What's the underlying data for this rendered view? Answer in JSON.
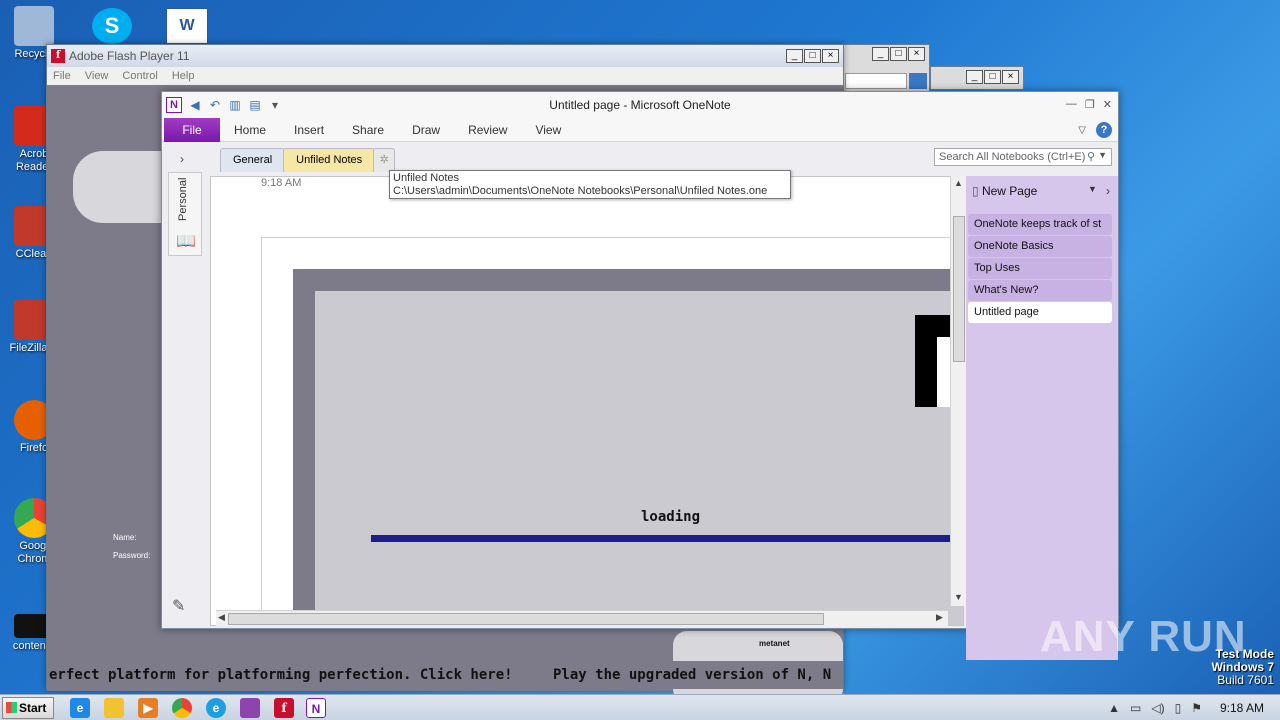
{
  "desktop": {
    "icons": [
      {
        "label": "Recycle",
        "color": "#9fb8d8"
      },
      {
        "label": "Acrob Reader",
        "color": "#d42a1c"
      },
      {
        "label": "CClean",
        "color": "#c0392b"
      },
      {
        "label": "FileZilla C",
        "color": "#c0392b"
      },
      {
        "label": "Firefo",
        "color": "#e66000"
      },
      {
        "label": "Googl Chrom",
        "color": "#34a853"
      },
      {
        "label": "contenta",
        "color": "#111111"
      }
    ]
  },
  "flash_window": {
    "title": "Adobe Flash Player 11",
    "menu": [
      "File",
      "View",
      "Control",
      "Help"
    ],
    "form_labels": [
      "Name:",
      "Password:"
    ],
    "ticker_left": "erfect platform for platforming perfection. Click here!",
    "ticker_right": "Play the upgraded version of N, N",
    "brand": "metanet"
  },
  "onenote": {
    "title": "Untitled page - Microsoft OneNote",
    "ribbon": {
      "file": "File",
      "tabs": [
        "Home",
        "Insert",
        "Share",
        "Draw",
        "Review",
        "View"
      ]
    },
    "notebook_label": "Personal",
    "section_tabs": [
      "General",
      "Unfiled Notes"
    ],
    "search_placeholder": "Search All Notebooks (Ctrl+E)",
    "page_time": "9:18 AM",
    "embed": {
      "loading_text": "loading"
    },
    "pages_pane": {
      "new_page": "New Page",
      "pages": [
        {
          "title": "OneNote keeps track of st",
          "active": false
        },
        {
          "title": "OneNote Basics",
          "active": false
        },
        {
          "title": "Top Uses",
          "active": false
        },
        {
          "title": "What's New?",
          "active": false
        },
        {
          "title": "Untitled page",
          "active": true
        }
      ]
    },
    "tooltip": {
      "title": "Unfiled Notes",
      "path": "C:\\Users\\admin\\Documents\\OneNote Notebooks\\Personal\\Unfiled Notes.one"
    }
  },
  "watermark": "ANY RUN",
  "build_info": {
    "line1": "Test Mode",
    "line2": "Windows 7",
    "line3": "Build 7601"
  },
  "taskbar": {
    "start_label": "Start",
    "clock": "9:18 AM"
  }
}
